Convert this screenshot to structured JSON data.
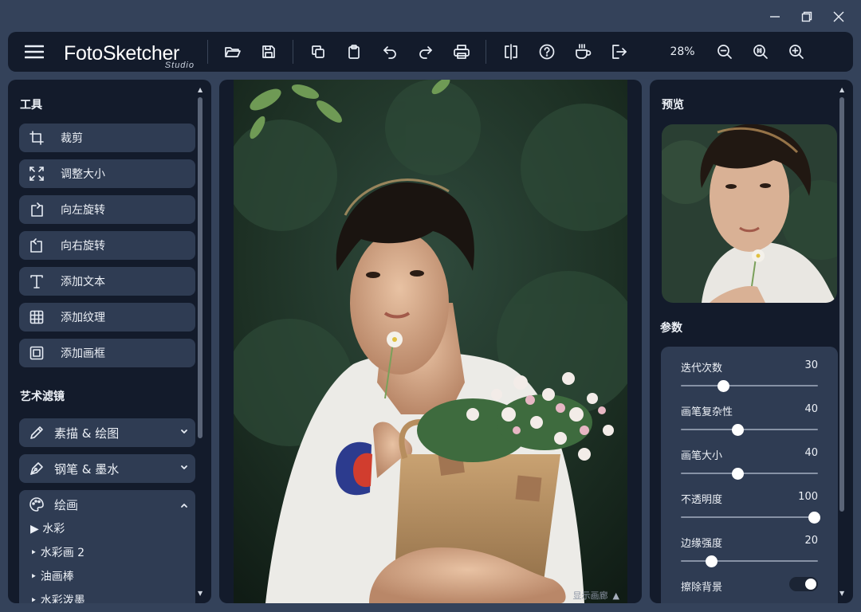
{
  "app": {
    "logo_main": "FotoSketcher",
    "logo_sub": "Studio"
  },
  "toolbar": {
    "zoom": "28%",
    "buttons": [
      "menu-icon",
      "open-folder-icon",
      "save-icon",
      "copy-icon",
      "paste-icon",
      "undo-icon",
      "redo-icon",
      "print-icon",
      "compare-icon",
      "help-icon",
      "coffee-icon",
      "exit-icon",
      "zoom-out-icon",
      "zoom-fit-icon",
      "zoom-in-icon"
    ]
  },
  "left": {
    "tools_title": "工具",
    "tools": [
      {
        "label": "裁剪",
        "icon": "crop-icon"
      },
      {
        "label": "调整大小",
        "icon": "resize-icon"
      },
      {
        "label": "向左旋转",
        "icon": "rotate-left-icon"
      },
      {
        "label": "向右旋转",
        "icon": "rotate-right-icon"
      },
      {
        "label": "添加文本",
        "icon": "text-icon"
      },
      {
        "label": "添加纹理",
        "icon": "texture-icon"
      },
      {
        "label": "添加画框",
        "icon": "frame-icon"
      }
    ],
    "filters_title": "艺术滤镜",
    "categories": [
      {
        "label": "素描 & 绘图",
        "icon": "pencil-icon"
      },
      {
        "label": "钢笔 & 墨水",
        "icon": "pen-icon"
      }
    ],
    "expanded_category": {
      "label": "绘画",
      "icon": "palette-icon",
      "items": [
        "▶ 水彩",
        "‣ 水彩画 2",
        "‣ 油画棒",
        "‣ 水彩泼墨"
      ]
    }
  },
  "center": {
    "show_canvas": "显示画廊"
  },
  "right": {
    "preview_title": "预览",
    "params_title": "参数",
    "params": [
      {
        "name": "迭代次数",
        "value": "30",
        "fraction": 0.31
      },
      {
        "name": "画笔复杂性",
        "value": "40",
        "fraction": 0.41
      },
      {
        "name": "画笔大小",
        "value": "40",
        "fraction": 0.41
      },
      {
        "name": "不透明度",
        "value": "100",
        "fraction": 0.97
      },
      {
        "name": "边缘强度",
        "value": "20",
        "fraction": 0.22
      }
    ],
    "toggle_label": "擦除背景",
    "toggle_on": true
  },
  "colors": {
    "background": "#34425a",
    "panel": "#131b2b",
    "button": "#2f3c53"
  }
}
